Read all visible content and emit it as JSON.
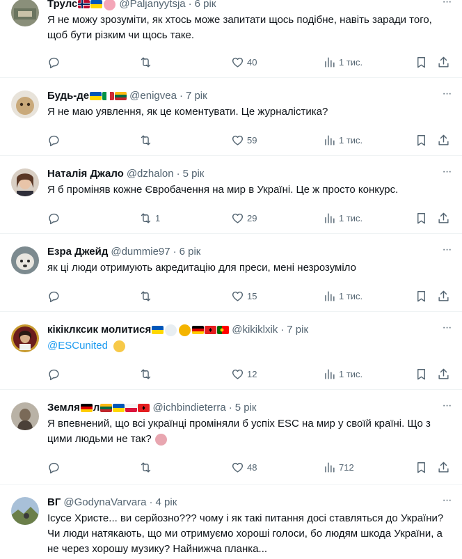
{
  "tweets": [
    {
      "name": "Трулс",
      "handle": "@Paljanyytsja",
      "time": "6 рік",
      "text": "Я не можу зрозуміти, як хтось може запитати щось подібне, навіть заради того, щоб бути різким чи щось таке.",
      "reply_count": "",
      "retweet_count": "",
      "like_count": "40",
      "view_count": "1 тис."
    },
    {
      "name": "Будь-де",
      "handle": "@enigvea",
      "time": "7 рік",
      "text": "Я не маю уявлення, як це коментувати. Це журналістика?",
      "reply_count": "",
      "retweet_count": "",
      "like_count": "59",
      "view_count": "1 тис."
    },
    {
      "name": "Наталія Джало",
      "handle": "@dzhalon",
      "time": "5 рік",
      "text": "Я б проміняв кожне Євробачення на мир в Україні. Це ж просто конкурс.",
      "reply_count": "",
      "retweet_count": "1",
      "like_count": "29",
      "view_count": "1 тис."
    },
    {
      "name": "Езра Джейд",
      "handle": "@dummie97",
      "time": "6 рік",
      "text": "як ці люди отримують акредитацію для преси, мені незрозуміло",
      "reply_count": "",
      "retweet_count": "",
      "like_count": "15",
      "view_count": "1 тис."
    },
    {
      "name": "кікіклксик молитися",
      "handle": "@kikiklxik",
      "time": "7 рік",
      "text": "@ESCunited",
      "reply_count": "",
      "retweet_count": "",
      "like_count": "12",
      "view_count": "1 тис."
    },
    {
      "name": "Земля",
      "name_suffix": "л",
      "handle": "@ichbindieterra",
      "time": "5 рік",
      "text": "Я впевнений, що всі українці проміняли б успіх ESC на мир у своїй країні. Що з цими людьми не так?",
      "reply_count": "",
      "retweet_count": "",
      "like_count": "48",
      "view_count": "712"
    },
    {
      "name": "ВГ",
      "handle": "@GodynaVarvara",
      "time": "4 рік",
      "text": "Ісусе Христе... ви серйозно??? чому і як такі питання досі ставляться до України? Чи люди натякають, що ми отримуємо хороші голоси, бо людям шкода України, а не через хорошу музику? Найнижча планка..."
    }
  ],
  "icons": {
    "reply": "reply-icon",
    "retweet": "retweet-icon",
    "like": "heart-icon",
    "views": "views-icon",
    "bookmark": "bookmark-icon",
    "share": "share-icon"
  },
  "colors": {
    "text": "#0f1419",
    "secondary": "#536471",
    "link": "#1d9bf0",
    "divider": "#eff3f4"
  }
}
